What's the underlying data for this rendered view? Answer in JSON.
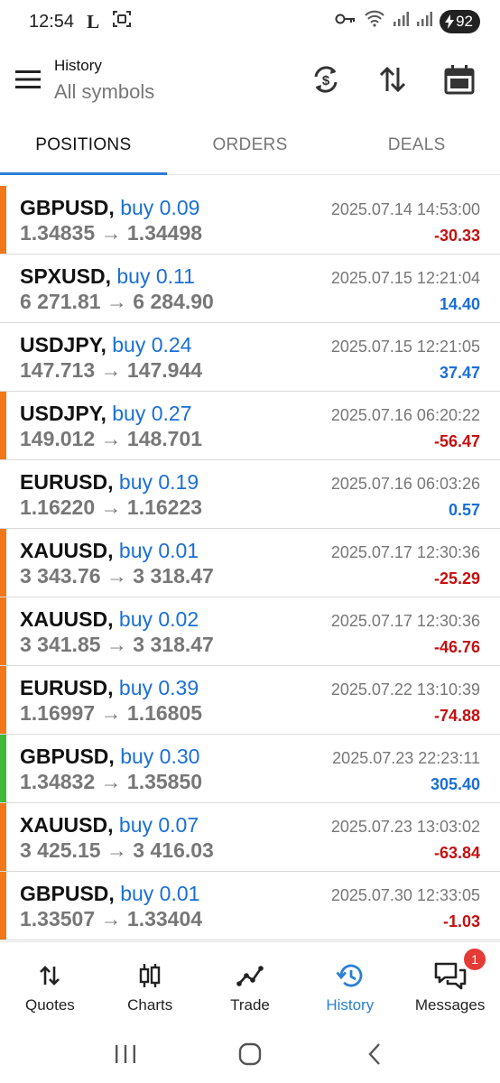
{
  "status_bar": {
    "time": "12:54",
    "letter": "L",
    "battery": "92"
  },
  "header": {
    "title": "History",
    "subtitle": "All symbols"
  },
  "tabs": [
    {
      "label": "POSITIONS",
      "active": true
    },
    {
      "label": "ORDERS",
      "active": false
    },
    {
      "label": "DEALS",
      "active": false
    }
  ],
  "positions": [
    {
      "symbol": "GBPUSD,",
      "side": "buy 0.09",
      "prices": "1.34835 → 1.34498",
      "date": "2025.07.14 14:53:00",
      "profit": "-30.33",
      "sign": "neg",
      "bar": "#f07818"
    },
    {
      "symbol": "SPXUSD,",
      "side": "buy 0.11",
      "prices": "6 271.81 → 6 284.90",
      "date": "2025.07.15 12:21:04",
      "profit": "14.40",
      "sign": "pos",
      "bar": ""
    },
    {
      "symbol": "USDJPY,",
      "side": "buy 0.24",
      "prices": "147.713 → 147.944",
      "date": "2025.07.15 12:21:05",
      "profit": "37.47",
      "sign": "pos",
      "bar": ""
    },
    {
      "symbol": "USDJPY,",
      "side": "buy 0.27",
      "prices": "149.012 → 148.701",
      "date": "2025.07.16 06:20:22",
      "profit": "-56.47",
      "sign": "neg",
      "bar": "#f07818"
    },
    {
      "symbol": "EURUSD,",
      "side": "buy 0.19",
      "prices": "1.16220 → 1.16223",
      "date": "2025.07.16 06:03:26",
      "profit": "0.57",
      "sign": "pos",
      "bar": ""
    },
    {
      "symbol": "XAUUSD,",
      "side": "buy 0.01",
      "prices": "3 343.76 → 3 318.47",
      "date": "2025.07.17 12:30:36",
      "profit": "-25.29",
      "sign": "neg",
      "bar": "#f07818"
    },
    {
      "symbol": "XAUUSD,",
      "side": "buy 0.02",
      "prices": "3 341.85 → 3 318.47",
      "date": "2025.07.17 12:30:36",
      "profit": "-46.76",
      "sign": "neg",
      "bar": "#f07818"
    },
    {
      "symbol": "EURUSD,",
      "side": "buy 0.39",
      "prices": "1.16997 → 1.16805",
      "date": "2025.07.22 13:10:39",
      "profit": "-74.88",
      "sign": "neg",
      "bar": "#f07818"
    },
    {
      "symbol": "GBPUSD,",
      "side": "buy 0.30",
      "prices": "1.34832 → 1.35850",
      "date": "2025.07.23 22:23:11",
      "profit": "305.40",
      "sign": "pos",
      "bar": "#3fba3a"
    },
    {
      "symbol": "XAUUSD,",
      "side": "buy 0.07",
      "prices": "3 425.15 → 3 416.03",
      "date": "2025.07.23 13:03:02",
      "profit": "-63.84",
      "sign": "neg",
      "bar": "#f07818"
    },
    {
      "symbol": "GBPUSD,",
      "side": "buy 0.01",
      "prices": "1.33507 → 1.33404",
      "date": "2025.07.30 12:33:05",
      "profit": "-1.03",
      "sign": "neg",
      "bar": "#f07818"
    }
  ],
  "bottom_nav": [
    {
      "label": "Quotes",
      "icon": "quotes-icon",
      "active": false
    },
    {
      "label": "Charts",
      "icon": "charts-icon",
      "active": false
    },
    {
      "label": "Trade",
      "icon": "trade-icon",
      "active": false
    },
    {
      "label": "History",
      "icon": "history-icon",
      "active": true
    },
    {
      "label": "Messages",
      "icon": "messages-icon",
      "active": false,
      "badge": "1"
    }
  ],
  "colors": {
    "accent": "#2a7fd4",
    "buy": "#1a6fd6",
    "loss": "#c41010",
    "loss_bar": "#f07818",
    "profit_bar": "#3fba3a"
  }
}
